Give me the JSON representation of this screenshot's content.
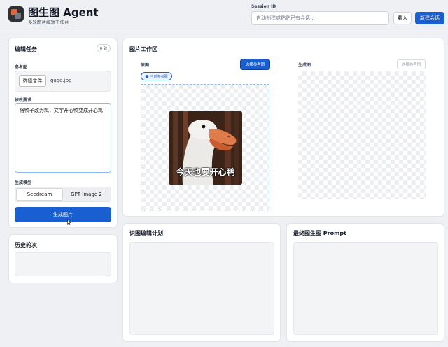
{
  "header": {
    "app_title": "图生图 Agent",
    "app_subtitle": "多轮图片编辑工作台",
    "session_label": "Session ID",
    "session_placeholder": "自动创建或粘贴已有会话...",
    "load_button": "载入",
    "new_session_button": "新建会话"
  },
  "task_panel": {
    "title": "编辑任务",
    "round_badge": "0 轮",
    "reference_label": "参考图",
    "choose_file_button": "选择文件",
    "file_name": "gaga.jpg",
    "prompt_label": "修改要求",
    "prompt_value": "将鸭子改为鸡，文字开心鸭变成开心鸡",
    "model_label": "生成模型",
    "models": [
      {
        "label": "Seedream",
        "selected": true
      },
      {
        "label": "GPT Image 2",
        "selected": false
      }
    ],
    "generate_button": "生成图片"
  },
  "history_panel": {
    "title": "历史轮次"
  },
  "workspace": {
    "title": "图片工作区",
    "original_label": "原图",
    "select_ref_button": "选择参考图",
    "current_ref_badge": "当前参考图",
    "generated_label": "生成图",
    "select_ref_button_disabled": "选择参考图",
    "image_caption": "今天也要开心鸭"
  },
  "plan_panel": {
    "title": "识图编辑计划"
  },
  "prompt_panel": {
    "title": "最终图生图 Prompt"
  },
  "colors": {
    "accent": "#1a5fd1",
    "background": "#eef0f3",
    "panel": "#ffffff"
  }
}
